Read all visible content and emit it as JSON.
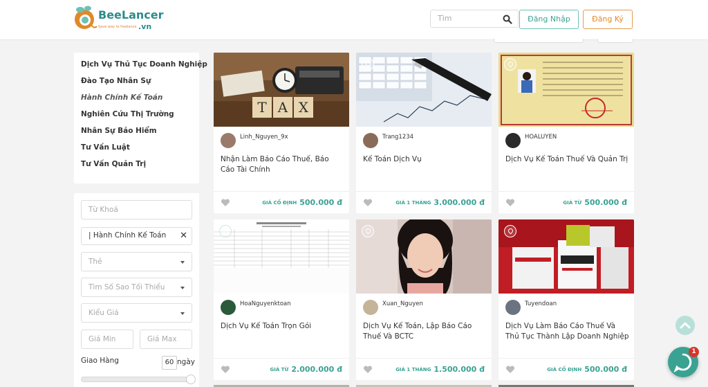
{
  "header": {
    "logo_name": "BeeLancer",
    "logo_suffix": ".vn",
    "logo_tagline": "Save way to freelance",
    "search_placeholder": "Tìm",
    "login_label": "Đăng Nhập",
    "register_label": "Đăng Ký"
  },
  "categories": [
    "Dịch Vụ Thủ Tục Doanh Nghiệp",
    "Đào Tạo Nhân Sự",
    "Hành Chính Kế Toán",
    "Nghiên Cứu Thị Trường",
    "Nhân Sự Bảo Hiểm",
    "Tư Vấn Luật",
    "Tư Vấn Quản Trị"
  ],
  "active_category": "Hành Chính Kế Toán",
  "filters": {
    "keyword_placeholder": "Từ Khoá",
    "category_tag": "|  Hành Chính Kế Toán",
    "tag_placeholder": "Thẻ",
    "min_stars_placeholder": "Tìm Số Sao Tối Thiểu",
    "price_type_placeholder": "Kiểu Giá",
    "price_min_placeholder": "Giá Min",
    "price_max_placeholder": "Giá Max",
    "delivery_label": "Giao Hàng",
    "delivery_days": "60",
    "delivery_unit": "ngày"
  },
  "cards": [
    {
      "user": "Linh_Nguyen_9x",
      "title": "Nhận Làm Báo Cáo Thuế, Báo Cáo Tài Chính",
      "price_label": "GIÁ CỐ ĐỊNH",
      "price": "500.000 đ",
      "image": "tax",
      "pin": false
    },
    {
      "user": "Trang1234",
      "title": "Kế Toán Dịch Vụ",
      "price_label": "GIÁ 1 THÁNG",
      "price": "3.000.000 đ",
      "image": "pen-chart",
      "pin": true
    },
    {
      "user": "HOALUYEN",
      "title": "Dịch Vụ Kế Toán Thuế Và Quản Trị",
      "price_label": "GIÁ TỪ",
      "price": "500.000 đ",
      "image": "certificate",
      "pin": true
    },
    {
      "user": "HoaNguyenktoan",
      "title": "Dịch Vụ Kế Toán Trọn Gói",
      "price_label": "GIÁ TỪ",
      "price": "2.000.000 đ",
      "image": "spreadsheet",
      "pin": true
    },
    {
      "user": "Xuan_Nguyen",
      "title": "Dịch Vụ Kế Toán, Lập Báo Cáo Thuế Và BCTC",
      "price_label": "GIÁ 1 THÁNG",
      "price": "1.500.000 đ",
      "image": "portrait",
      "pin": true
    },
    {
      "user": "Tuyendoan",
      "title": "Dịch Vụ Làm Báo Cáo Thuế Và Thủ Tục Thành Lập Doanh Nghiệp",
      "price_label": "GIÁ CỐ ĐỊNH",
      "price": "500.000 đ",
      "image": "boxes",
      "pin": true
    }
  ],
  "chat_badge": "1",
  "colors": {
    "accent": "#3aa292",
    "brand_orange": "#e0892a"
  }
}
